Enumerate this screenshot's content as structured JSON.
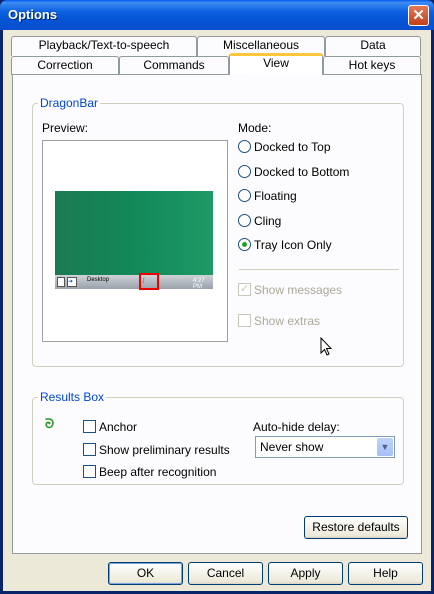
{
  "window": {
    "title": "Options",
    "close_label": "✕"
  },
  "tabs": {
    "row1": [
      "Playback/Text-to-speech",
      "Miscellaneous",
      "Data"
    ],
    "row2": [
      "Correction",
      "Commands",
      "View",
      "Hot keys"
    ],
    "active": "View"
  },
  "dragonbar": {
    "legend": "DragonBar",
    "preview_label": "Preview:",
    "preview_taskbar_text": "Desktop",
    "preview_clock": "4:27 PM",
    "mode_label": "Mode:",
    "modes": [
      "Docked to Top",
      "Docked to Bottom",
      "Floating",
      "Cling",
      "Tray Icon Only"
    ],
    "selected_mode": "Tray Icon Only",
    "show_messages": {
      "label": "Show messages",
      "checked": true,
      "enabled": false
    },
    "show_extras": {
      "label": "Show extras",
      "checked": false,
      "enabled": false
    }
  },
  "results_box": {
    "legend": "Results Box",
    "anchor": {
      "label": "Anchor",
      "checked": false
    },
    "show_preliminary": {
      "label": "Show preliminary results",
      "checked": false
    },
    "beep": {
      "label": "Beep after recognition",
      "checked": false
    },
    "autohide_label": "Auto-hide delay:",
    "autohide_value": "Never show"
  },
  "buttons": {
    "restore_defaults": "Restore defaults",
    "ok": "OK",
    "cancel": "Cancel",
    "apply": "Apply",
    "help": "Help"
  },
  "colors": {
    "accent": "#0046d5",
    "active_tab_highlight": "#ffc83c",
    "radio_dot": "#21a121",
    "titlebar": "#0553d4"
  }
}
